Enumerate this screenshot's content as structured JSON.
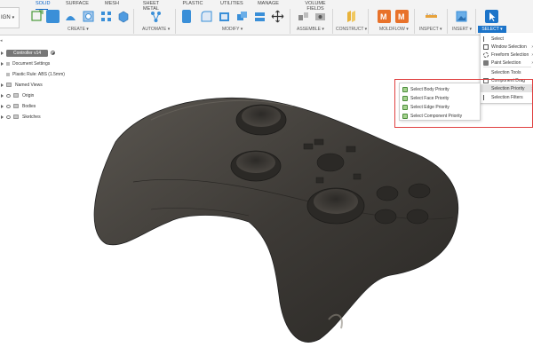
{
  "app": {
    "workspace_label": "IGN",
    "tabs": [
      "SOLID",
      "SURFACE",
      "MESH",
      "SHEET METAL",
      "PLASTIC",
      "UTILITIES",
      "MANAGE",
      "VOLUME FIELDS"
    ],
    "active_tab": "SOLID"
  },
  "ribbon": {
    "groups": {
      "create": "CREATE ▾",
      "automate": "AUTOMATE ▾",
      "modify": "MODIFY ▾",
      "assemble": "ASSEMBLE ▾",
      "construct": "CONSTRUCT ▾",
      "moldflow": "MOLDFLOW ▾",
      "inspect": "INSPECT ▾",
      "insert": "INSERT ▾",
      "select": "SELECT ▾"
    },
    "colors": {
      "accent": "#1c74c9",
      "moldflow": "#e8722a",
      "tool_blue": "#3a8fd8"
    }
  },
  "browser": {
    "root": "Controller v14",
    "items": [
      {
        "label": "Document Settings",
        "icon": "gear-icon"
      },
      {
        "label": "Plastic Rule: ABS (1.5mm)",
        "icon": "rule-icon"
      },
      {
        "label": "Named Views",
        "icon": "folder-icon"
      },
      {
        "label": "Origin",
        "icon": "folder-icon"
      },
      {
        "label": "Bodies",
        "icon": "folder-icon"
      },
      {
        "label": "Sketches",
        "icon": "folder-icon"
      }
    ]
  },
  "select_menu": {
    "items": [
      {
        "label": "Select",
        "icon": "cursor-icon"
      },
      {
        "label": "Window Selection",
        "icon": "window-select-icon",
        "more": "›"
      },
      {
        "label": "Freeform Selection",
        "icon": "freeform-select-icon",
        "more": "›"
      },
      {
        "label": "Paint Selection",
        "icon": "paint-select-icon",
        "more": "›"
      },
      {
        "label": "Selection Tools",
        "icon": "tools-icon"
      },
      {
        "label": "Component Drag",
        "icon": "checkbox-icon"
      },
      {
        "label": "Selection Priority",
        "icon": "",
        "more": "›",
        "highlighted": true
      },
      {
        "label": "Selection Filters",
        "icon": "filter-icon"
      }
    ]
  },
  "priority_menu": {
    "items": [
      "Select Body Priority",
      "Select Face Priority",
      "Select Edge Priority",
      "Select Component Priority"
    ]
  },
  "viewport": {
    "model_color": "#3d3a36",
    "highlight_color": "#e04040"
  }
}
